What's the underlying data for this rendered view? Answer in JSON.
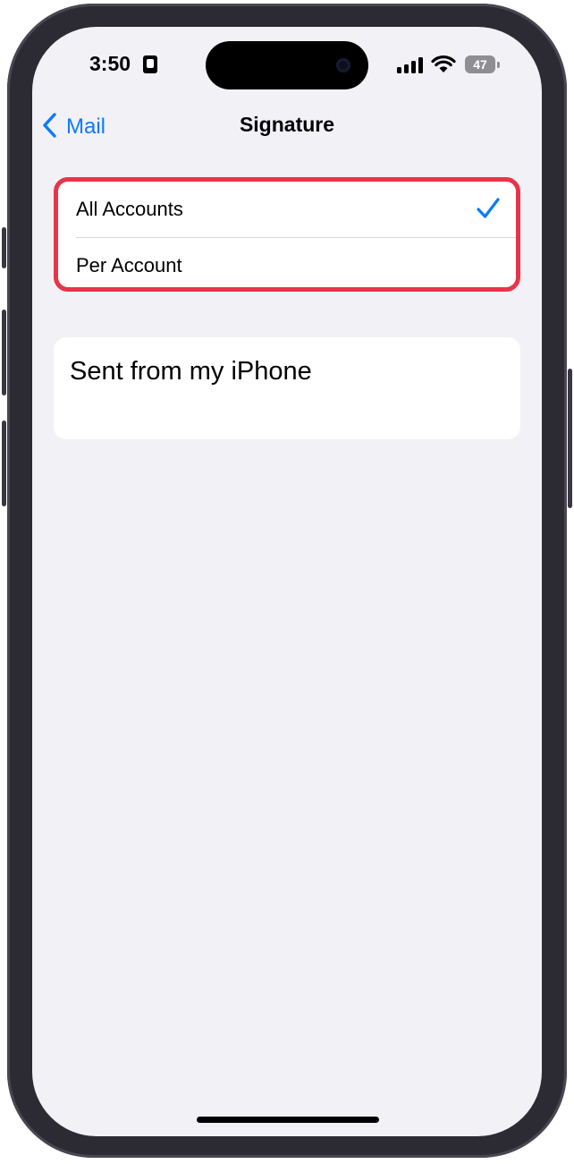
{
  "status_bar": {
    "time": "3:50",
    "battery_level": "47",
    "time_icon": "person-card-icon",
    "signal_icon": "cellular-signal-icon",
    "wifi_icon": "wifi-icon",
    "battery_icon": "battery-icon"
  },
  "nav": {
    "back_label": "Mail",
    "back_icon": "chevron-left-icon",
    "title": "Signature"
  },
  "options": {
    "items": [
      {
        "label": "All Accounts",
        "selected": true
      },
      {
        "label": "Per Account",
        "selected": false
      }
    ],
    "highlight_color": "#e8344a"
  },
  "signature": {
    "text": "Sent from my iPhone"
  },
  "colors": {
    "accent": "#0a7aff",
    "background": "#f2f1f6"
  }
}
